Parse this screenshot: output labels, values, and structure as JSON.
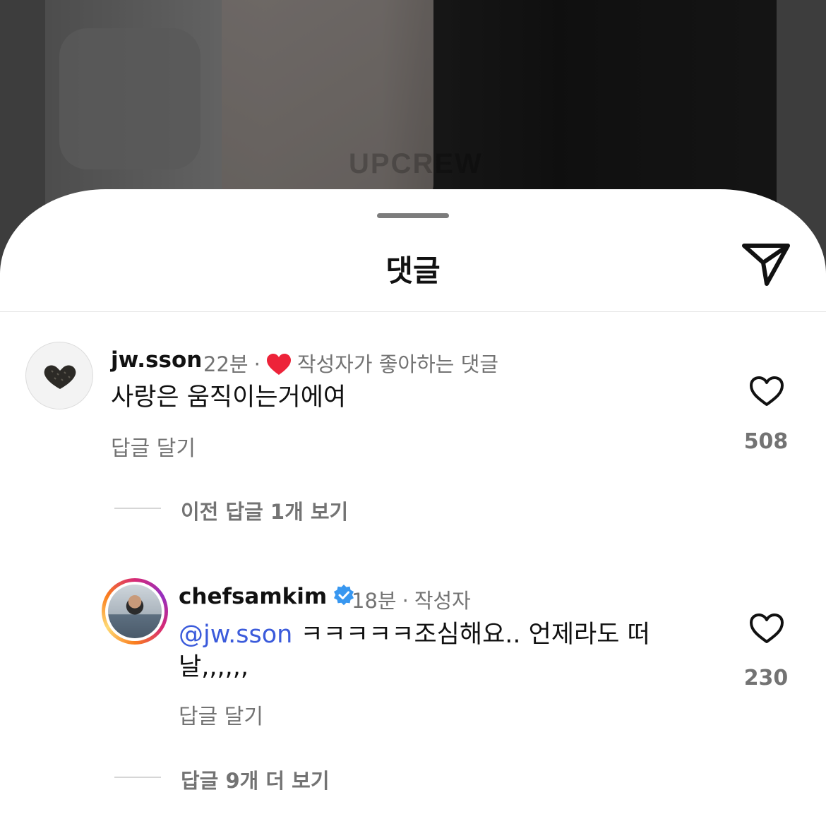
{
  "background": {
    "watermark": "UPCREW"
  },
  "sheet": {
    "title": "댓글"
  },
  "comments": [
    {
      "username": "jw.sson",
      "time": "22분",
      "badge": "작성자가 좋아하는 댓글",
      "text": "사랑은 움직이는거에여",
      "reply_label": "답글 달기",
      "likes": "508"
    },
    {
      "username": "chefsamkim",
      "time": "18분",
      "role": "작성자",
      "mention": "@jw.sson",
      "text_line1": "ㅋㅋㅋㅋㅋ조심해요.. 언제라도 떠",
      "text_line2": "날,,,,,,",
      "reply_label": "답글 달기",
      "likes": "230"
    }
  ],
  "threads": {
    "previous_replies": "이전 답글 1개 보기",
    "more_replies": "답글 9개 더 보기"
  },
  "colors": {
    "heart": "#ed2339",
    "mention": "#3b5bdb",
    "verified": "#3897f0"
  }
}
